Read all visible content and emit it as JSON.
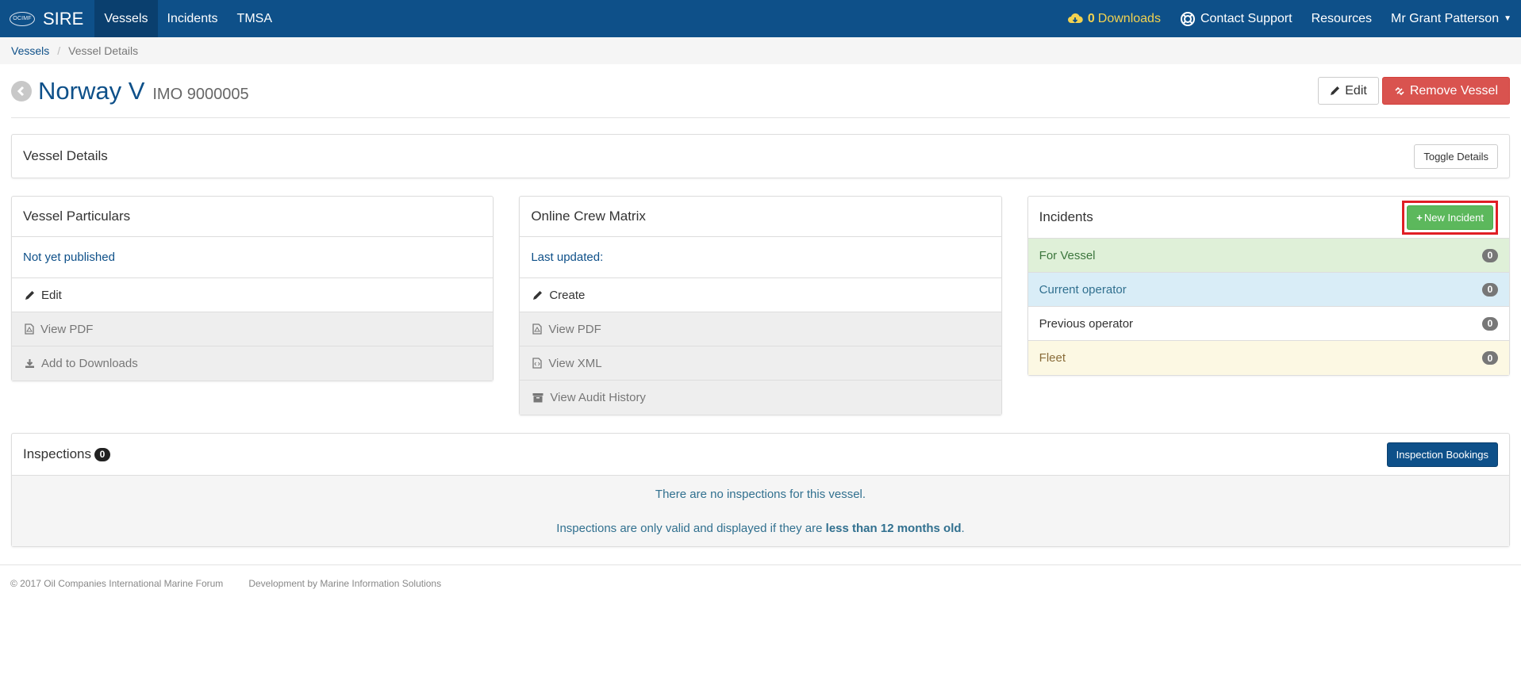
{
  "nav": {
    "logo_text": "OCIMF",
    "brand": "SIRE",
    "items": [
      {
        "label": "Vessels",
        "active": true
      },
      {
        "label": "Incidents",
        "active": false
      },
      {
        "label": "TMSA",
        "active": false
      }
    ],
    "downloads_count": "0",
    "downloads_label": "Downloads",
    "contact_support": "Contact Support",
    "resources": "Resources",
    "user": "Mr Grant Patterson"
  },
  "breadcrumb": {
    "root": "Vessels",
    "current": "Vessel Details"
  },
  "header": {
    "vessel_name": "Norway V",
    "imo": "IMO 9000005",
    "edit_label": "Edit",
    "remove_label": "Remove Vessel"
  },
  "details_panel": {
    "title": "Vessel Details",
    "toggle_label": "Toggle Details"
  },
  "particulars": {
    "title": "Vessel Particulars",
    "status": "Not yet published",
    "actions": [
      "Edit",
      "View PDF",
      "Add to Downloads"
    ]
  },
  "crew_matrix": {
    "title": "Online Crew Matrix",
    "status": "Last updated:",
    "actions": [
      "Create",
      "View PDF",
      "View XML",
      "View Audit History"
    ]
  },
  "incidents": {
    "title": "Incidents",
    "new_label": "New Incident",
    "rows": [
      {
        "label": "For Vessel",
        "count": "0"
      },
      {
        "label": "Current operator",
        "count": "0"
      },
      {
        "label": "Previous operator",
        "count": "0"
      },
      {
        "label": "Fleet",
        "count": "0"
      }
    ]
  },
  "inspections": {
    "title": "Inspections",
    "count": "0",
    "bookings_label": "Inspection Bookings",
    "empty_message": "There are no inspections for this vessel.",
    "note_prefix": "Inspections are only valid and displayed if they are ",
    "note_bold": "less than 12 months old",
    "note_suffix": "."
  },
  "footer": {
    "copyright": "© 2017 Oil Companies International Marine Forum",
    "developer": "Development by Marine Information Solutions"
  },
  "colors": {
    "navbar": "#0e5089",
    "downloads": "#f3d24f",
    "danger": "#d9534f",
    "success": "#5cb85c",
    "highlight_box": "#e01e25"
  }
}
